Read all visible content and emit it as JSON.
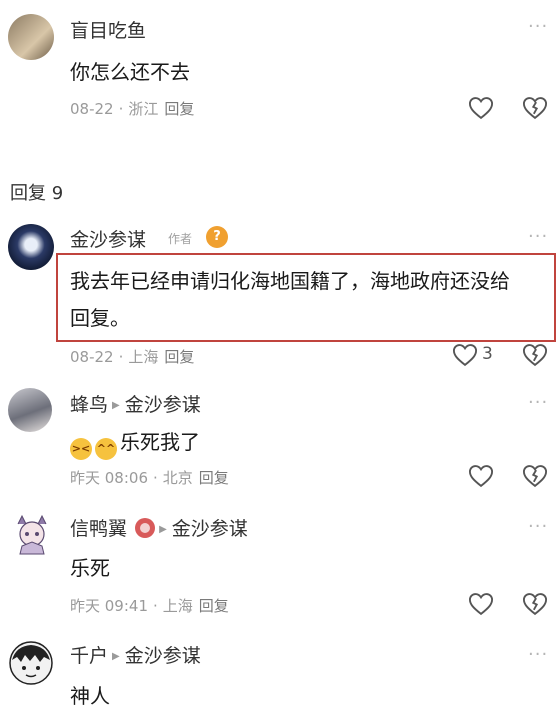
{
  "comments": [
    {
      "username": "盲目吃鱼",
      "content": "你怎么还不去",
      "date": "08-22",
      "location": "浙江",
      "reply_label": "回复"
    },
    {
      "username": "金沙参谋",
      "author_badge": "作者",
      "content_line1": "我去年已经申请归化海地国籍了，海地政府还没给",
      "content_line2": "回复。",
      "date": "08-22",
      "location": "上海",
      "reply_label": "回复",
      "like_count": "3"
    },
    {
      "username": "蜂鸟",
      "reply_to": "金沙参谋",
      "content": "乐死我了",
      "date": "昨天 08:06",
      "location": "北京",
      "reply_label": "回复"
    },
    {
      "username": "信鸭翼",
      "reply_to": "金沙参谋",
      "content": "乐死",
      "date": "昨天 09:41",
      "location": "上海",
      "reply_label": "回复"
    },
    {
      "username": "千户",
      "reply_to": "金沙参谋",
      "content": "神人"
    }
  ],
  "reply_section": {
    "label": "回复 9"
  },
  "icons": {
    "more": "more-icon",
    "like": "heart-icon",
    "dislike": "broken-heart-icon",
    "reply_arrow": "reply-arrow-icon"
  },
  "colors": {
    "highlight_border": "#c0443e",
    "meta_text": "#9a9a9a",
    "badge_orange": "#f0a030"
  }
}
